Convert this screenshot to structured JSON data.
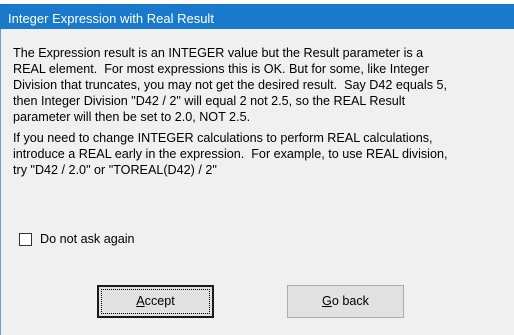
{
  "window": {
    "title": "Integer Expression with Real Result"
  },
  "message": {
    "paragraph1_lines": [
      "The Expression result is an INTEGER value but the Result parameter is a",
      "REAL element.  For most expressions this is OK. But for some, like Integer",
      "Division that truncates, you may not get the desired result.  Say D42 equals 5,",
      "then Integer Division \"D42 / 2\" will equal 2 not 2.5, so the REAL Result",
      "parameter will then be set to 2.0, NOT 2.5."
    ],
    "paragraph2_lines": [
      "If you need to change INTEGER calculations to perform REAL calculations,",
      "introduce a REAL early in the expression.  For example, to use REAL division,",
      "try \"D42 / 2.0\" or \"TOREAL(D42) / 2\""
    ]
  },
  "options": {
    "do_not_ask_label": "Do not ask again",
    "do_not_ask_checked": false
  },
  "buttons": {
    "accept": {
      "mnemonic": "A",
      "rest": "ccept"
    },
    "go_back": {
      "mnemonic": "G",
      "rest": "o back"
    }
  },
  "colors": {
    "titlebar": "#1979ca",
    "title_text": "#ffffff",
    "client_background": "#f0f0f0",
    "button_face": "#e1e1e1"
  }
}
